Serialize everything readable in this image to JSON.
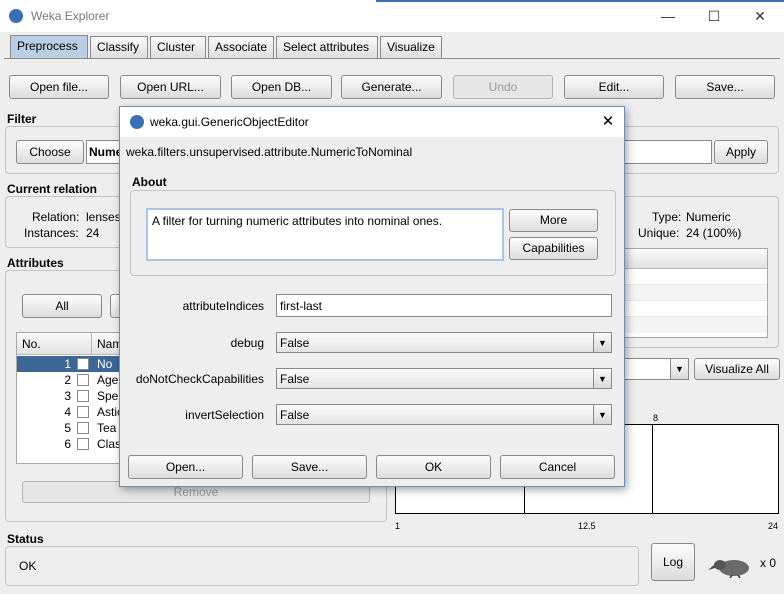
{
  "window": {
    "title": "Weka Explorer",
    "minimize": "—",
    "maximize": "☐",
    "close": "✕"
  },
  "tabs": [
    "Preprocess",
    "Classify",
    "Cluster",
    "Associate",
    "Select attributes",
    "Visualize"
  ],
  "toolbar": {
    "open_file": "Open file...",
    "open_url": "Open URL...",
    "open_db": "Open DB...",
    "generate": "Generate...",
    "undo": "Undo",
    "edit": "Edit...",
    "save": "Save..."
  },
  "filter": {
    "heading": "Filter",
    "choose": "Choose",
    "value": "Nume",
    "apply": "Apply"
  },
  "current_relation": {
    "heading": "Current relation",
    "relation_label": "Relation:",
    "relation_value": "lenses",
    "instances_label": "Instances:",
    "instances_value": "24"
  },
  "selected_attr": {
    "type_label": "Type:",
    "type_value": "Numeric",
    "unique_label": "Unique:",
    "unique_value": "24 (100%)"
  },
  "attributes": {
    "heading": "Attributes",
    "all_button": "All",
    "col_no": "No.",
    "col_name": "Nam",
    "rows": [
      {
        "no": "1",
        "name": "No"
      },
      {
        "no": "2",
        "name": "Age"
      },
      {
        "no": "3",
        "name": "Spe"
      },
      {
        "no": "4",
        "name": "Astic"
      },
      {
        "no": "5",
        "name": "Tea"
      },
      {
        "no": "6",
        "name": "Clas"
      }
    ],
    "remove": "Remove"
  },
  "visualize_all": "Visualize All",
  "histogram": {
    "bar_label": "8",
    "tick_min": "1",
    "tick_mid": "12.5",
    "tick_max": "24"
  },
  "status": {
    "heading": "Status",
    "text": "OK",
    "log": "Log",
    "x_count": "x 0"
  },
  "dialog": {
    "title": "weka.gui.GenericObjectEditor",
    "class_name": "weka.filters.unsupervised.attribute.NumericToNominal",
    "about_heading": "About",
    "about_text": "A filter for turning numeric attributes into nominal ones.",
    "more": "More",
    "capabilities": "Capabilities",
    "props": {
      "attributeIndices": {
        "label": "attributeIndices",
        "value": "first-last"
      },
      "debug": {
        "label": "debug",
        "value": "False"
      },
      "doNotCheckCapabilities": {
        "label": "doNotCheckCapabilities",
        "value": "False"
      },
      "invertSelection": {
        "label": "invertSelection",
        "value": "False"
      }
    },
    "open": "Open...",
    "save": "Save...",
    "ok": "OK",
    "cancel": "Cancel",
    "close": "✕"
  }
}
